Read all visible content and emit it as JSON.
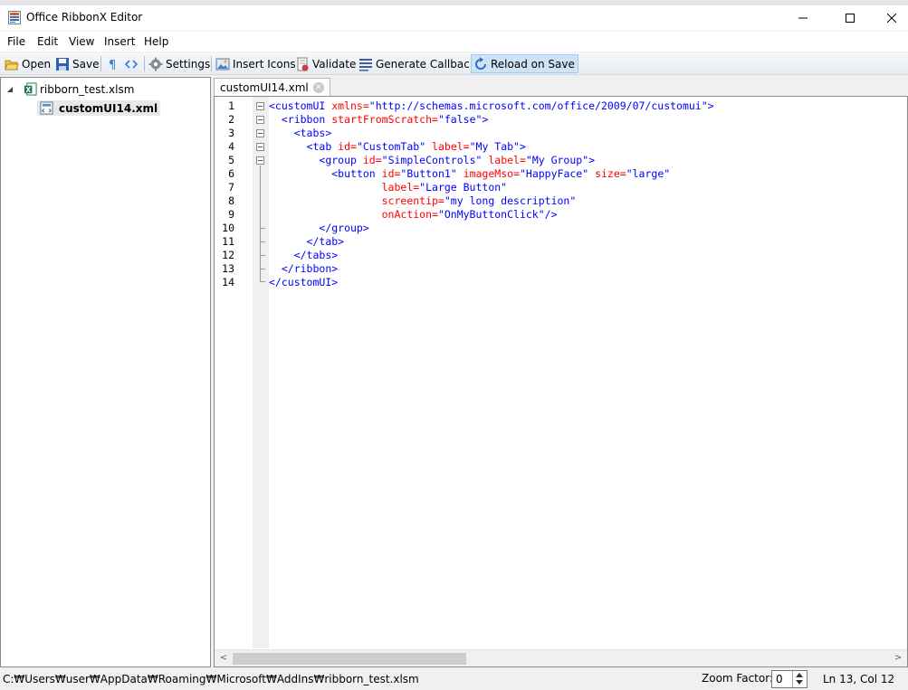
{
  "window": {
    "title": "Office RibbonX Editor",
    "minimize_glyph": "—",
    "maximize_glyph": "☐",
    "close_glyph": "✕"
  },
  "menu": {
    "items": [
      "File",
      "Edit",
      "View",
      "Insert",
      "Help"
    ]
  },
  "toolbar": {
    "open": "Open",
    "save": "Save",
    "settings": "Settings",
    "insert_icons": "Insert Icons",
    "validate": "Validate",
    "generate_callbacks": "Generate Callbacks",
    "reload_on_save": "Reload on Save"
  },
  "tree": {
    "root": "ribborn_test.xlsm",
    "child": "customUI14.xml"
  },
  "editor": {
    "tab_label": "customUI14.xml",
    "line_numbers": [
      "1",
      "2",
      "3",
      "4",
      "5",
      "6",
      "7",
      "8",
      "9",
      "10",
      "11",
      "12",
      "13",
      "14"
    ]
  },
  "code": {
    "l1": {
      "open": "<customUI",
      "attr1": " xmlns=",
      "val1": "\"http://schemas.microsoft.com/office/2009/07/customui\"",
      "close": ">"
    },
    "l2": {
      "indent": "  ",
      "open": "<ribbon",
      "attr1": " startFromScratch=",
      "val1": "\"false\"",
      "close": ">"
    },
    "l3": {
      "indent": "    ",
      "open": "<tabs>"
    },
    "l4": {
      "indent": "      ",
      "open": "<tab",
      "attr1": " id=",
      "val1": "\"CustomTab\"",
      "attr2": " label=",
      "val2": "\"My Tab\"",
      "close": ">"
    },
    "l5": {
      "indent": "        ",
      "open": "<group",
      "attr1": " id=",
      "val1": "\"SimpleControls\"",
      "attr2": " label=",
      "val2": "\"My Group\"",
      "close": ">"
    },
    "l6": {
      "indent": "          ",
      "open": "<button",
      "attr1": " id=",
      "val1": "\"Button1\"",
      "attr2": " imageMso=",
      "val2": "\"HappyFace\"",
      "attr3": " size=",
      "val3": "\"large\""
    },
    "l7": {
      "indent": "                  ",
      "attr1": "label=",
      "val1": "\"Large Button\""
    },
    "l8": {
      "indent": "                  ",
      "attr1": "screentip=",
      "val1": "\"my long description\""
    },
    "l9": {
      "indent": "                  ",
      "attr1": "onAction=",
      "val1": "\"OnMyButtonClick\"",
      "close": "/>"
    },
    "l10": {
      "indent": "        ",
      "open": "</group>"
    },
    "l11": {
      "indent": "      ",
      "open": "</tab>"
    },
    "l12": {
      "indent": "    ",
      "open": "</tabs>"
    },
    "l13": {
      "indent": "  ",
      "open": "</ribbon>"
    },
    "l14": {
      "open": "</customUI>"
    }
  },
  "status": {
    "path": "C:₩Users₩user₩AppData₩Roaming₩Microsoft₩AddIns₩ribborn_test.xlsm",
    "zoom_label": "Zoom Factor:",
    "zoom_value": "0",
    "position": "Ln 13,  Col 12"
  },
  "colors": {
    "tag": "#0000ff",
    "attribute": "#ff0000",
    "value": "#a31515",
    "toolbar_active": "#cfe3f6"
  },
  "icons": [
    "app-icon",
    "open-folder-icon",
    "save-disk-icon",
    "pilcrow-icon",
    "code-brackets-icon",
    "gear-icon",
    "insert-image-icon",
    "validate-icon",
    "callbacks-icon",
    "reload-icon",
    "excel-file-icon",
    "xml-file-icon",
    "expand-triangle-icon"
  ]
}
